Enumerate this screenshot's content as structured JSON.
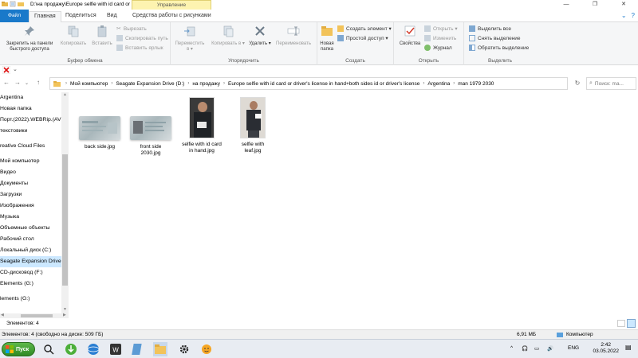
{
  "window": {
    "title": "D:\\на продажу\\Europe selfie with id card or ...",
    "context_tab": "Управление",
    "minimize_label": "—",
    "maximize_label": "❐",
    "close_label": "✕"
  },
  "ribbon_tabs": {
    "file": "Файл",
    "home": "Главная",
    "share": "Поделиться",
    "view": "Вид",
    "picture_tools": "Средства работы с рисунками"
  },
  "ribbon": {
    "clipboard": {
      "label": "Буфер обмена",
      "pin": "Закрепить на панели быстрого доступа",
      "copy": "Копировать",
      "paste": "Вставить",
      "cut": "Вырезать",
      "copy_path": "Скопировать путь",
      "paste_shortcut": "Вставить ярлык"
    },
    "organize": {
      "label": "Упорядочить",
      "move_to": "Переместить в ▾",
      "copy_to": "Копировать в ▾",
      "delete": "Удалить ▾",
      "rename": "Переименовать"
    },
    "new": {
      "label": "Создать",
      "new_folder": "Новая папка",
      "new_item": "Создать элемент ▾",
      "easy_access": "Простой доступ ▾"
    },
    "open": {
      "label": "Открыть",
      "properties": "Свойства",
      "open": "Открыть ▾",
      "edit": "Изменить",
      "history": "Журнал"
    },
    "select": {
      "label": "Выделить",
      "select_all": "Выделить все",
      "select_none": "Снять выделение",
      "invert": "Обратить выделение"
    }
  },
  "address": {
    "crumbs": [
      "Мой компьютер",
      "Seagate Expansion Drive (D:)",
      "на продажу",
      "Europe selfie with id card or driver's license in hand+both sides id or driver's license",
      "Argentina",
      "man 1979 2030"
    ],
    "search_placeholder": "Поиск: ma..."
  },
  "nav_items": [
    "Argentina",
    "Новая папка",
    "Порт.(2022).WEBRip.(AV",
    "текстовики",
    "reative Cloud Files",
    "Мой компьютер",
    "Видео",
    "Документы",
    "Загрузки",
    "Изображения",
    "Музыка",
    "Объемные объекты",
    "Рабочий стол",
    "Локальный диск (C:)",
    "Seagate Expansion Drive",
    "CD-дисковод (F:)",
    "Elements (G:)",
    "lements (G:)"
  ],
  "files": [
    {
      "name_line1": "back side.jpg",
      "name_line2": ""
    },
    {
      "name_line1": "front side",
      "name_line2": "2030.jpg"
    },
    {
      "name_line1": "selfie with id card",
      "name_line2": "in hand.jpg"
    },
    {
      "name_line1": "selfie with",
      "name_line2": "leaf.jpg"
    }
  ],
  "status": {
    "count": "Элементов: 4",
    "detail": "Элементов: 4 (свободно на диске: 509 ГБ)",
    "size": "6,91 МБ",
    "location": "Компьютер"
  },
  "taskbar": {
    "start": "Пуск",
    "lang": "ENG",
    "time": "2:42",
    "date": "03.05.2022"
  },
  "colors": {
    "accent": "#1979ca",
    "selection": "#cce8ff",
    "manage_tab": "#fdf3b0"
  }
}
